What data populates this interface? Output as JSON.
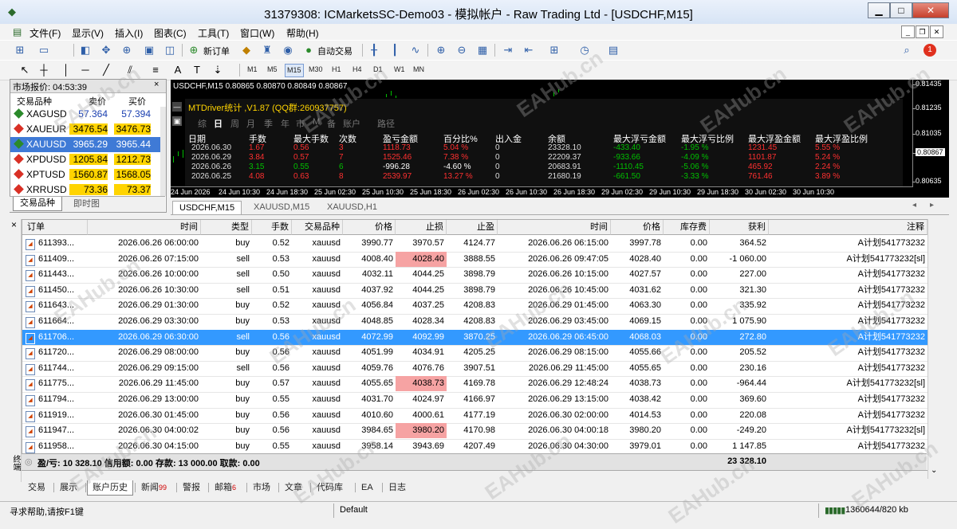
{
  "window": {
    "title": "31379308: ICMarketsSC-Demo03 - 模拟帐户 - Raw Trading Ltd - [USDCHF,M15]",
    "minimize": "▁",
    "maximize": "□",
    "close": "✕"
  },
  "menu": {
    "items": [
      "文件(F)",
      "显示(V)",
      "插入(I)",
      "图表(C)",
      "工具(T)",
      "窗口(W)",
      "帮助(H)"
    ],
    "notification_count": "1"
  },
  "toolbar": {
    "new_order": "新订单",
    "auto_trading": "自动交易",
    "timeframes": [
      "M1",
      "M5",
      "M15",
      "M30",
      "H1",
      "H4",
      "D1",
      "W1",
      "MN"
    ],
    "selected_timeframe": "M15"
  },
  "market_watch": {
    "title": "市场报价: 04:53:39",
    "columns": [
      "交易品种",
      "卖价",
      "买价"
    ],
    "rows": [
      {
        "symbol": "XAGUSD",
        "bid": "57.364",
        "ask": "57.394"
      },
      {
        "symbol": "XAUEUR",
        "bid": "3476.54",
        "ask": "3476.73"
      },
      {
        "symbol": "XAUUSD",
        "bid": "3965.29",
        "ask": "3965.44"
      },
      {
        "symbol": "XPDUSD",
        "bid": "1205.84",
        "ask": "1212.73"
      },
      {
        "symbol": "XPTUSD",
        "bid": "1560.87",
        "ask": "1568.05"
      },
      {
        "symbol": "XRRUSD",
        "bid": "73.36",
        "ask": "73.37"
      }
    ],
    "tabs": [
      "交易品种",
      "即时图"
    ]
  },
  "chart": {
    "header": "USDCHF,M15  0.80865 0.80870 0.80849 0.80867",
    "prices": [
      "0.81435",
      "0.81235",
      "0.81035",
      "0.80867",
      "0.80635"
    ],
    "times": [
      "24 Jun 2026",
      "24 Jun 10:30",
      "24 Jun 18:30",
      "25 Jun 02:30",
      "25 Jun 10:30",
      "25 Jun 18:30",
      "26 Jun 02:30",
      "26 Jun 10:30",
      "26 Jun 18:30",
      "29 Jun 02:30",
      "29 Jun 10:30",
      "29 Jun 18:30",
      "30 Jun 02:30",
      "30 Jun 10:30"
    ],
    "tabs": [
      "USDCHF,M15",
      "XAUUSD,M15",
      "XAUUSD,H1"
    ]
  },
  "stats_panel": {
    "title": "MTDriver统计 ,V1.87 (QQ群:260937757)",
    "periods": [
      "综",
      "日",
      "周",
      "月",
      "季",
      "年",
      "市",
      "M",
      "备",
      "账户",
      "路径"
    ],
    "columns": [
      "日期",
      "手数",
      "最大手数",
      "次数",
      "盈亏金额",
      "百分比%",
      "出入金",
      "余额",
      "最大浮亏金额",
      "最大浮亏比例",
      "最大浮盈金额",
      "最大浮盈比例"
    ],
    "rows": [
      [
        "2026.06.30",
        "1.67",
        "0.56",
        "3",
        "1118.73",
        "5.04 %",
        "0",
        "23328.10",
        "-433.40",
        "-1.95 %",
        "1231.45",
        "5.55 %"
      ],
      [
        "2026.06.29",
        "3.84",
        "0.57",
        "7",
        "1525.46",
        "7.38 %",
        "0",
        "22209.37",
        "-933.66",
        "-4.09 %",
        "1101.87",
        "5.24 %"
      ],
      [
        "2026.06.26",
        "3.15",
        "0.55",
        "6",
        "-996.28",
        "-4.60 %",
        "0",
        "20683.91",
        "-1110.45",
        "-5.06 %",
        "465.92",
        "2.24 %"
      ],
      [
        "2026.06.25",
        "4.08",
        "0.63",
        "8",
        "2539.97",
        "13.27 %",
        "0",
        "21680.19",
        "-661.50",
        "-3.33 %",
        "761.46",
        "3.89 %"
      ]
    ]
  },
  "history": {
    "columns": [
      "订单",
      "时间",
      "类型",
      "手数",
      "交易品种",
      "价格",
      "止损",
      "止盈",
      "时间",
      "价格",
      "库存费",
      "获利",
      "注释"
    ],
    "rows": [
      [
        "611393...",
        "2026.06.26 06:00:00",
        "buy",
        "0.52",
        "xauusd",
        "3990.77",
        "3970.57",
        "4124.77",
        "2026.06.26 06:15:00",
        "3997.78",
        "0.00",
        "364.52",
        "A计划541773232"
      ],
      [
        "611409...",
        "2026.06.26 07:15:00",
        "sell",
        "0.53",
        "xauusd",
        "4008.40",
        "4028.40",
        "3888.55",
        "2026.06.26 09:47:05",
        "4028.40",
        "0.00",
        "-1 060.00",
        "A计划541773232[sl]"
      ],
      [
        "611443...",
        "2026.06.26 10:00:00",
        "sell",
        "0.50",
        "xauusd",
        "4032.11",
        "4044.25",
        "3898.79",
        "2026.06.26 10:15:00",
        "4027.57",
        "0.00",
        "227.00",
        "A计划541773232"
      ],
      [
        "611450...",
        "2026.06.26 10:30:00",
        "sell",
        "0.51",
        "xauusd",
        "4037.92",
        "4044.25",
        "3898.79",
        "2026.06.26 10:45:00",
        "4031.62",
        "0.00",
        "321.30",
        "A计划541773232"
      ],
      [
        "611643...",
        "2026.06.29 01:30:00",
        "buy",
        "0.52",
        "xauusd",
        "4056.84",
        "4037.25",
        "4208.83",
        "2026.06.29 01:45:00",
        "4063.30",
        "0.00",
        "335.92",
        "A计划541773232"
      ],
      [
        "611664...",
        "2026.06.29 03:30:00",
        "buy",
        "0.53",
        "xauusd",
        "4048.85",
        "4028.34",
        "4208.83",
        "2026.06.29 03:45:00",
        "4069.15",
        "0.00",
        "1 075.90",
        "A计划541773232"
      ],
      [
        "611706...",
        "2026.06.29 06:30:00",
        "sell",
        "0.56",
        "xauusd",
        "4072.99",
        "4092.99",
        "3870.25",
        "2026.06.29 06:45:00",
        "4068.03",
        "0.00",
        "272.80",
        "A计划541773232"
      ],
      [
        "611720...",
        "2026.06.29 08:00:00",
        "buy",
        "0.56",
        "xauusd",
        "4051.99",
        "4034.91",
        "4205.25",
        "2026.06.29 08:15:00",
        "4055.66",
        "0.00",
        "205.52",
        "A计划541773232"
      ],
      [
        "611744...",
        "2026.06.29 09:15:00",
        "sell",
        "0.56",
        "xauusd",
        "4059.76",
        "4076.76",
        "3907.51",
        "2026.06.29 11:45:00",
        "4055.65",
        "0.00",
        "230.16",
        "A计划541773232"
      ],
      [
        "611775...",
        "2026.06.29 11:45:00",
        "buy",
        "0.57",
        "xauusd",
        "4055.65",
        "4038.73",
        "4169.78",
        "2026.06.29 12:48:24",
        "4038.73",
        "0.00",
        "-964.44",
        "A计划541773232[sl]"
      ],
      [
        "611794...",
        "2026.06.29 13:00:00",
        "buy",
        "0.55",
        "xauusd",
        "4031.70",
        "4024.97",
        "4166.97",
        "2026.06.29 13:15:00",
        "4038.42",
        "0.00",
        "369.60",
        "A计划541773232"
      ],
      [
        "611919...",
        "2026.06.30 01:45:00",
        "buy",
        "0.56",
        "xauusd",
        "4010.60",
        "4000.61",
        "4177.19",
        "2026.06.30 02:00:00",
        "4014.53",
        "0.00",
        "220.08",
        "A计划541773232"
      ],
      [
        "611947...",
        "2026.06.30 04:00:02",
        "buy",
        "0.56",
        "xauusd",
        "3984.65",
        "3980.20",
        "4170.98",
        "2026.06.30 04:00:18",
        "3980.20",
        "0.00",
        "-249.20",
        "A计划541773232[sl]"
      ],
      [
        "611958...",
        "2026.06.30 04:15:00",
        "buy",
        "0.55",
        "xauusd",
        "3958.14",
        "3943.69",
        "4207.49",
        "2026.06.30 04:30:00",
        "3979.01",
        "0.00",
        "1 147.85",
        "A计划541773232"
      ]
    ],
    "sl_hit_rows": [
      1,
      9,
      12
    ],
    "selected_row": 6,
    "summary": "盈/亏: 10 328.10  信用额: 0.00  存款: 13 000.00  取款: 0.00",
    "summary_total": "23 328.10"
  },
  "bottom_tabs": [
    {
      "label": "交易",
      "badge": ""
    },
    {
      "label": "展示",
      "badge": ""
    },
    {
      "label": "账户历史",
      "badge": ""
    },
    {
      "label": "新闻",
      "badge": "99"
    },
    {
      "label": "警报",
      "badge": ""
    },
    {
      "label": "邮箱",
      "badge": "6"
    },
    {
      "label": "市场",
      "badge": ""
    },
    {
      "label": "文章",
      "badge": ""
    },
    {
      "label": "代码库",
      "badge": ""
    },
    {
      "label": "EA",
      "badge": ""
    },
    {
      "label": "日志",
      "badge": ""
    }
  ],
  "side_label": "终端",
  "status": {
    "help": "寻求帮助,请按F1键",
    "profile": "Default",
    "traffic": "1360644/820 kb"
  },
  "watermark": "EAHub.cn",
  "colors": {
    "up": "#ffd400",
    "down": "#d93025",
    "selected": "#3399ff",
    "sl_hit": "#f6a3a3",
    "positive_text": "#00c000",
    "negative_text": "#ff3030"
  }
}
